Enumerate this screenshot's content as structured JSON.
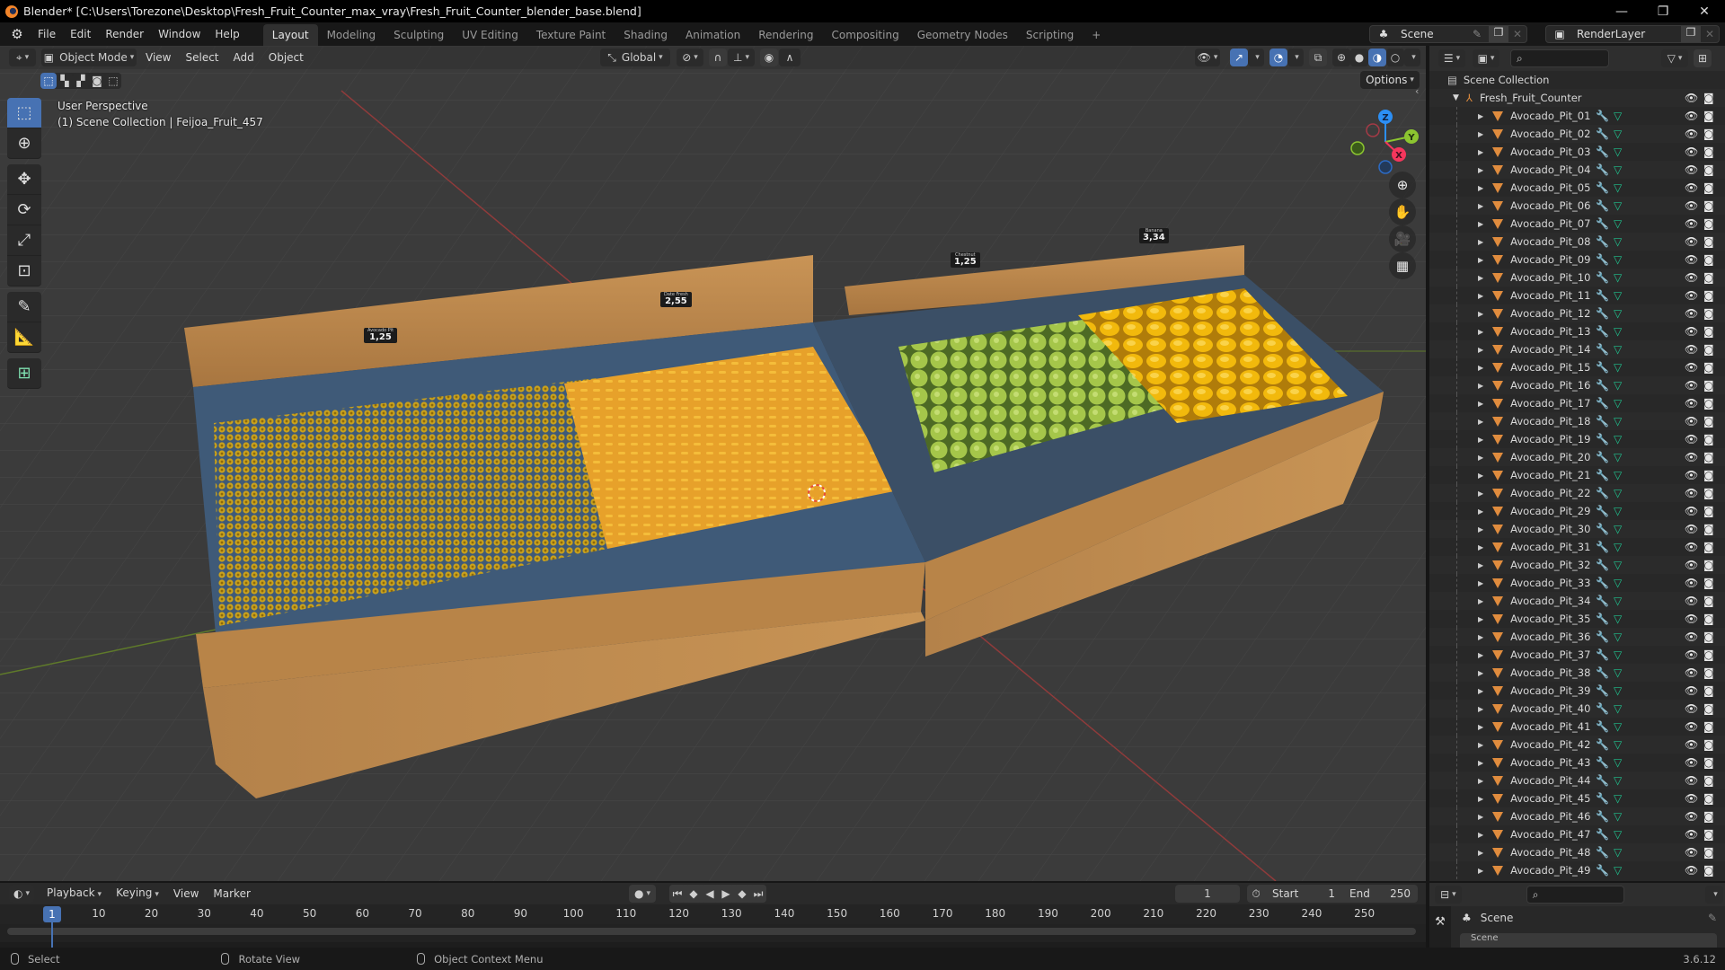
{
  "window": {
    "title": "Blender* [C:\\Users\\Torezone\\Desktop\\Fresh_Fruit_Counter_max_vray\\Fresh_Fruit_Counter_blender_base.blend]",
    "controls": {
      "minimize": "—",
      "restore": "❐",
      "close": "✕"
    }
  },
  "menu": [
    "File",
    "Edit",
    "Render",
    "Window",
    "Help"
  ],
  "workspaces": {
    "tabs": [
      "Layout",
      "Modeling",
      "Sculpting",
      "UV Editing",
      "Texture Paint",
      "Shading",
      "Animation",
      "Rendering",
      "Compositing",
      "Geometry Nodes",
      "Scripting"
    ],
    "active": "Layout",
    "add_label": "+"
  },
  "scene_selector": {
    "label": "Scene"
  },
  "view_layer_selector": {
    "label": "RenderLayer"
  },
  "viewport": {
    "mode": "Object Mode",
    "menus": [
      "View",
      "Select",
      "Add",
      "Object"
    ],
    "orientation": "Global",
    "options_label": "Options",
    "info_line1": "User Perspective",
    "info_line2": "(1) Scene Collection | Feijoa_Fruit_457",
    "gizmo_axes": {
      "x": "X",
      "y": "Y",
      "z": "Z"
    },
    "colors": {
      "x": "#f5365c",
      "y": "#8cc530",
      "z": "#2c8ff5",
      "accent": "#4772b3"
    },
    "price_tags": [
      {
        "name": "Avocado Pit",
        "price": "1,25"
      },
      {
        "name": "Date Fresh",
        "price": "2,55"
      },
      {
        "name": "Chestnut",
        "price": "1,25"
      },
      {
        "name": "Banana",
        "price": "3,34"
      }
    ],
    "tools": [
      "select-box",
      "cursor",
      "move",
      "rotate",
      "scale",
      "transform",
      "annotate",
      "measure",
      "add-cube"
    ]
  },
  "outliner": {
    "root": "Scene Collection",
    "collection": "Fresh_Fruit_Counter",
    "items": [
      "Avocado_Pit_01",
      "Avocado_Pit_02",
      "Avocado_Pit_03",
      "Avocado_Pit_04",
      "Avocado_Pit_05",
      "Avocado_Pit_06",
      "Avocado_Pit_07",
      "Avocado_Pit_08",
      "Avocado_Pit_09",
      "Avocado_Pit_10",
      "Avocado_Pit_11",
      "Avocado_Pit_12",
      "Avocado_Pit_13",
      "Avocado_Pit_14",
      "Avocado_Pit_15",
      "Avocado_Pit_16",
      "Avocado_Pit_17",
      "Avocado_Pit_18",
      "Avocado_Pit_19",
      "Avocado_Pit_20",
      "Avocado_Pit_21",
      "Avocado_Pit_22",
      "Avocado_Pit_29",
      "Avocado_Pit_30",
      "Avocado_Pit_31",
      "Avocado_Pit_32",
      "Avocado_Pit_33",
      "Avocado_Pit_34",
      "Avocado_Pit_35",
      "Avocado_Pit_36",
      "Avocado_Pit_37",
      "Avocado_Pit_38",
      "Avocado_Pit_39",
      "Avocado_Pit_40",
      "Avocado_Pit_41",
      "Avocado_Pit_42",
      "Avocado_Pit_43",
      "Avocado_Pit_44",
      "Avocado_Pit_45",
      "Avocado_Pit_46",
      "Avocado_Pit_47",
      "Avocado_Pit_48",
      "Avocado_Pit_49"
    ],
    "search_placeholder": ""
  },
  "properties": {
    "context": "Scene",
    "panel_partial": "Scene",
    "search_placeholder": ""
  },
  "timeline": {
    "menus": [
      "Playback",
      "Keying",
      "View",
      "Marker"
    ],
    "current_frame": "1",
    "start_label": "Start",
    "start": "1",
    "end_label": "End",
    "end": "250",
    "ticks": [
      "10",
      "20",
      "30",
      "40",
      "50",
      "60",
      "70",
      "80",
      "90",
      "100",
      "110",
      "120",
      "130",
      "140",
      "150",
      "160",
      "170",
      "180",
      "190",
      "200",
      "210",
      "220",
      "230",
      "240",
      "250"
    ]
  },
  "statusbar": {
    "hints": [
      "Select",
      "Rotate View",
      "Object Context Menu"
    ],
    "version": "3.6.12"
  }
}
